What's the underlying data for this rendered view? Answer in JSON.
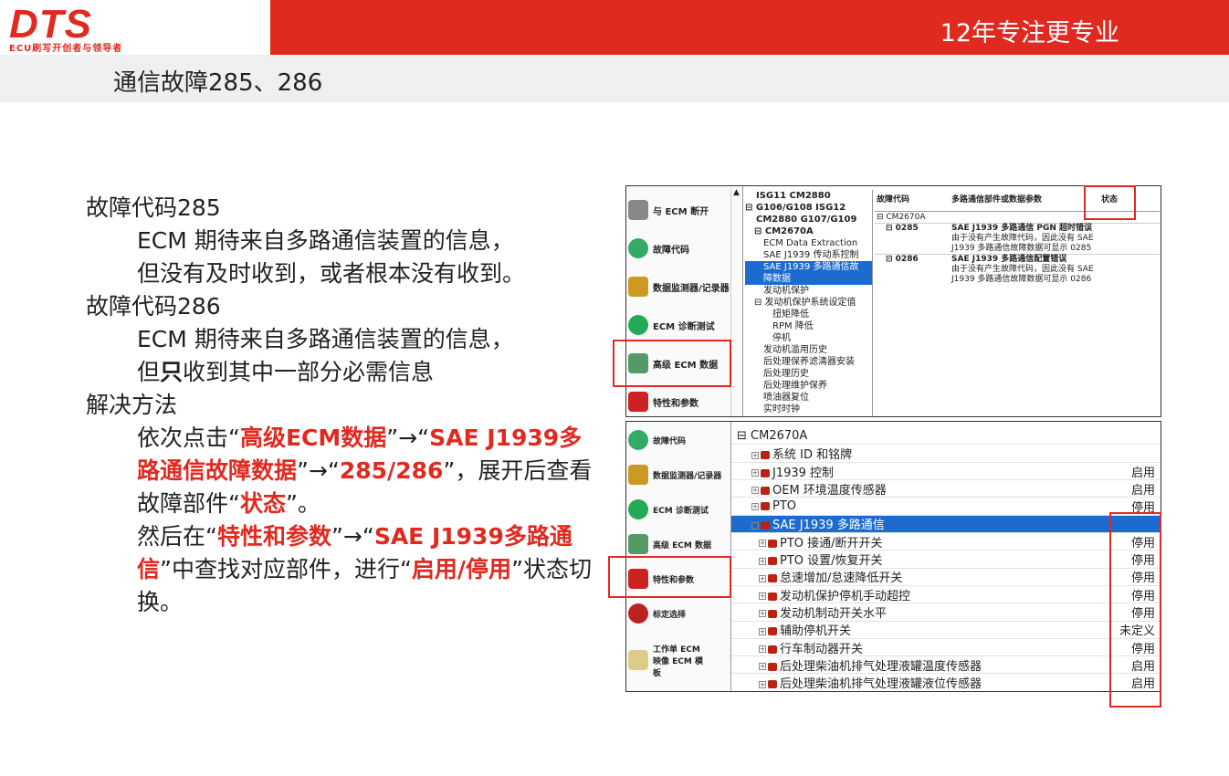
{
  "header": {
    "logo": "DTS",
    "logo_sub": "ECU刷写开创者与领导者",
    "slogan": "12年专注更专业"
  },
  "page_title": "通信故障285、286",
  "body": {
    "line1": "故障代码285",
    "line2": "ECM 期待来自多路通信装置的信息，",
    "line3": "但没有及时收到，或者根本没有收到。",
    "line4": "故障代码286",
    "line5": "ECM 期待来自多路通信装置的信息，",
    "line6a": "但",
    "line6b": "只",
    "line6c": "收到其中一部分必需信息",
    "line7": "解决方法",
    "s1": "依次点击“",
    "s2": "高级ECM数据",
    "s3": "”→“",
    "s4": "SAE J1939多路通信故障数据",
    "s5": "”→“",
    "s6": "285/286",
    "s7": "”，展开后查看故障部件“",
    "s8": "状态",
    "s9": "”。",
    "t1": "然后在“",
    "t2": "特性和参数",
    "t3": "”→“",
    "t4": "SAE J1939多路通信",
    "t5": "”中查找对应部件，进行“",
    "t6": "启用/停用",
    "t7": "”状态切换。"
  },
  "panel1": {
    "nav": [
      "与 ECM 断开",
      "故障代码",
      "数据监测器/记录器",
      "ECM 诊断测试",
      "高级 ECM 数据",
      "特性和参数"
    ],
    "tree": [
      "ISG11 CM2880",
      "⊟ G106/G108 ISG12",
      "CM2880 G107/G109",
      "⊟ CM2670A",
      "ECM Data Extraction",
      "SAE J1939 传动系控制",
      "SAE J1939 多路通信故",
      "障数据",
      "发动机保护",
      "⊟ 发动机保护系统设定值",
      "扭矩降低",
      "RPM 降低",
      "停机",
      "发动机滥用历史",
      "后处理保养滤清器安装",
      "后处理历史",
      "后处理维护保养",
      "喷油器复位",
      "实时时钟"
    ],
    "headers": [
      "故障代码",
      "多路通信部件或数据参数",
      "状态"
    ],
    "rows": [
      "⊟ CM2670A",
      "⊟ 0285",
      "SAE J1939 多路通信 PGN 超时错误",
      "由于没有产生故障代码，因此没有 SAE",
      "J1939 多路通信故障数据可显示 0285",
      "⊟ 0286",
      "SAE J1939 多路通信配置错误",
      "由于没有产生故障代码，因此没有 SAE",
      "J1939 多路通信故障数据可显示 0286"
    ]
  },
  "panel2": {
    "nav": [
      "故障代码",
      "数据监测器/记录器",
      "ECM 诊断测试",
      "高级 ECM 数据",
      "特性和参数",
      "标定选择",
      "工作单 ECM 映像 ECM 模板"
    ],
    "root": "⊟ CM2670A",
    "rows": [
      {
        "label": "系统 ID 和铭牌",
        "value": ""
      },
      {
        "label": "J1939 控制",
        "value": "启用"
      },
      {
        "label": "OEM 环境温度传感器",
        "value": "启用"
      },
      {
        "label": "PTO",
        "value": "停用"
      },
      {
        "label": "SAE J1939 多路通信",
        "value": ""
      },
      {
        "label": "PTO 接通/断开开关",
        "value": "停用"
      },
      {
        "label": "PTO 设置/恢复开关",
        "value": "停用"
      },
      {
        "label": "怠速增加/怠速降低开关",
        "value": "停用"
      },
      {
        "label": "发动机保护停机手动超控",
        "value": "停用"
      },
      {
        "label": "发动机制动开关水平",
        "value": "停用"
      },
      {
        "label": "辅助停机开关",
        "value": "未定义"
      },
      {
        "label": "行车制动器开关",
        "value": "停用"
      },
      {
        "label": "后处理柴油机排气处理液罐温度传感器",
        "value": "启用"
      },
      {
        "label": "后处理柴油机排气处理液罐液位传感器",
        "value": "启用"
      }
    ]
  },
  "colors": {
    "brand_red": "#e02a20",
    "select_blue": "#1e6bcf"
  }
}
